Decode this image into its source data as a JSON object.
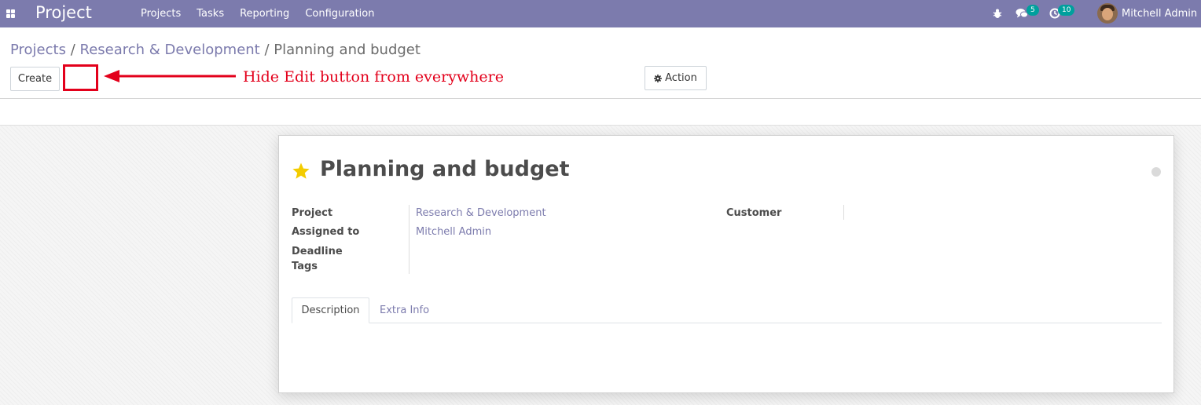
{
  "navbar": {
    "app_title": "Project",
    "menu": [
      "Projects",
      "Tasks",
      "Reporting",
      "Configuration"
    ],
    "chat_count": "5",
    "activity_count": "10",
    "user_name": "Mitchell Admin",
    "bg_color": "#7c7bad"
  },
  "breadcrumb": {
    "items": [
      "Projects",
      "Research & Development"
    ],
    "separator": "/",
    "current": "Planning and budget"
  },
  "buttons": {
    "create_label": "Create",
    "action_label": "Action"
  },
  "annotation": {
    "text": "Hide Edit button from everywhere",
    "color": "#e3001b"
  },
  "record": {
    "title": "Planning and budget",
    "starred": true,
    "fields": {
      "project_label": "Project",
      "project_value": "Research & Development",
      "assigned_label": "Assigned to",
      "assigned_value": "Mitchell Admin",
      "deadline_label": "Deadline",
      "tags_label": "Tags",
      "customer_label": "Customer"
    },
    "tabs": [
      "Description",
      "Extra Info"
    ],
    "active_tab": "Description"
  },
  "icons": [
    "apps-icon",
    "bug-icon",
    "chat-icon",
    "clock-icon",
    "gear-icon",
    "star-icon",
    "arrow-icon"
  ]
}
